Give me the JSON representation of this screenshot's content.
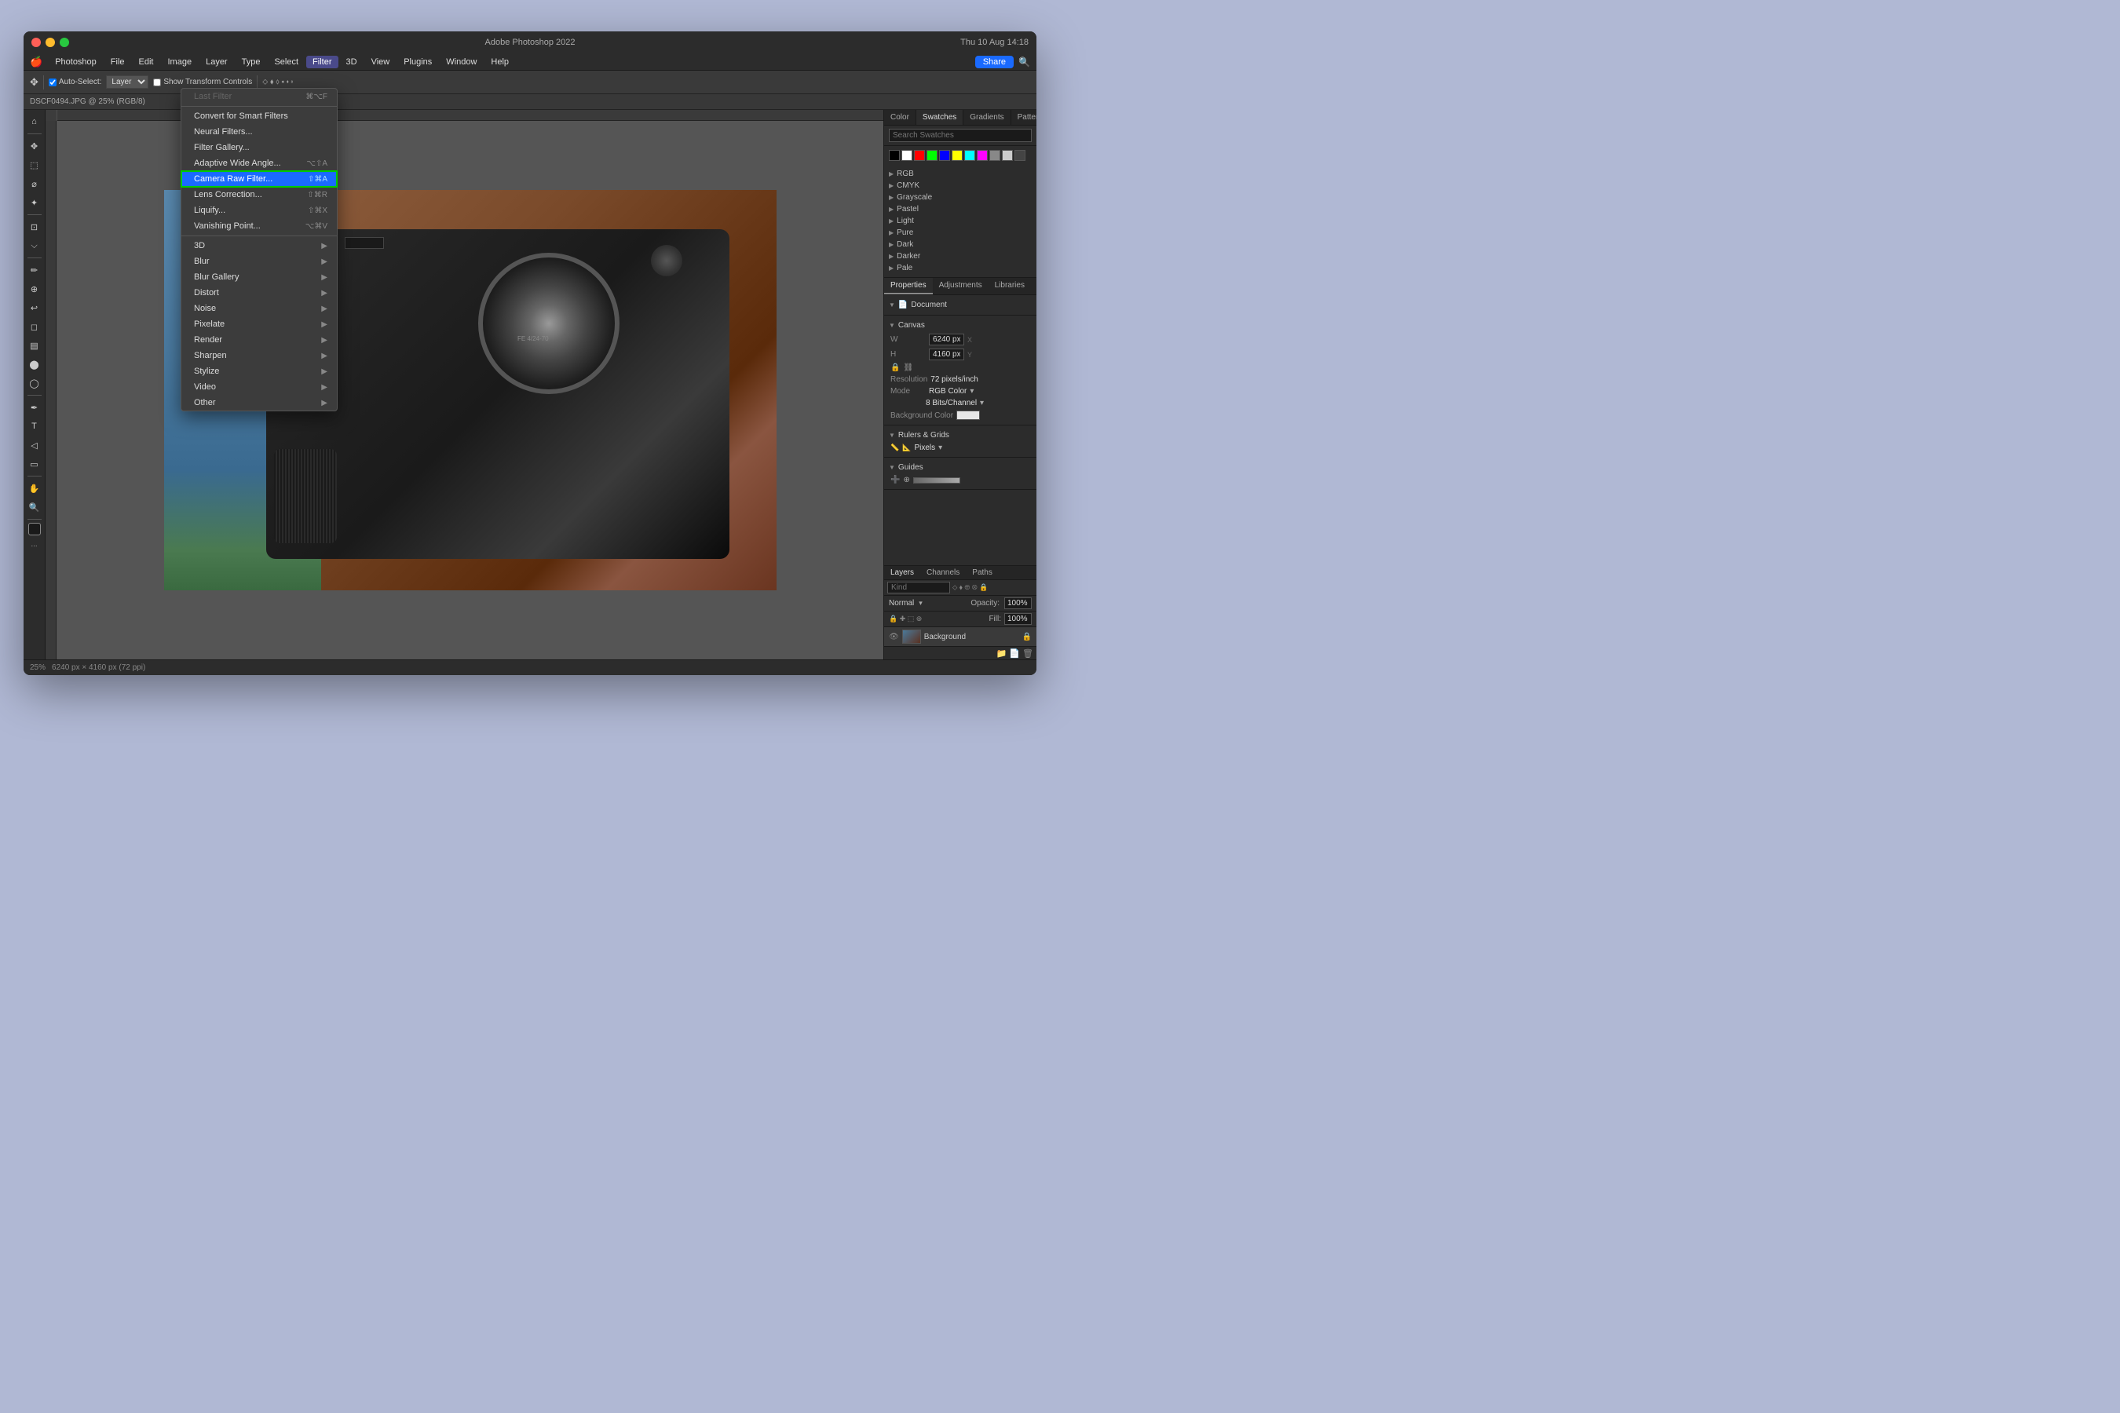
{
  "window": {
    "title": "Adobe Photoshop 2022",
    "datetime": "Thu 10 Aug  14:18"
  },
  "menubar": {
    "apple": "🍎",
    "items": [
      "Photoshop",
      "File",
      "Edit",
      "Image",
      "Layer",
      "Type",
      "Select",
      "Filter",
      "3D",
      "View",
      "Plugins",
      "Window",
      "Help"
    ]
  },
  "toolbar": {
    "auto_select_label": "Auto-Select:",
    "auto_select_value": "Layer",
    "show_transform": "Show Transform Controls"
  },
  "file_info": {
    "name": "DSCF0494.JPG @ 25% (RGB/8)",
    "zoom": "25%",
    "dimensions": "6240 px × 4160 px (72 ppi)"
  },
  "filter_menu": {
    "items": [
      {
        "label": "Last Filter",
        "shortcut": "⌘⌥F",
        "disabled": false,
        "id": "last-filter"
      },
      {
        "separator": true
      },
      {
        "label": "Convert for Smart Filters",
        "shortcut": "",
        "disabled": false
      },
      {
        "label": "Neural Filters...",
        "shortcut": "",
        "disabled": false
      },
      {
        "label": "Filter Gallery...",
        "shortcut": "",
        "disabled": false
      },
      {
        "label": "Adaptive Wide Angle...",
        "shortcut": "⌥⇧A",
        "disabled": false
      },
      {
        "label": "Camera Raw Filter...",
        "shortcut": "⇧⌘A",
        "disabled": false,
        "highlighted": true
      },
      {
        "label": "Lens Correction...",
        "shortcut": "⇧⌘R",
        "disabled": false
      },
      {
        "label": "Liquify...",
        "shortcut": "⇧⌘X",
        "disabled": false
      },
      {
        "label": "Vanishing Point...",
        "shortcut": "⌥⌘V",
        "disabled": false
      },
      {
        "separator": true
      },
      {
        "label": "3D",
        "hasSubmenu": true
      },
      {
        "label": "Blur",
        "hasSubmenu": true
      },
      {
        "label": "Blur Gallery",
        "hasSubmenu": true
      },
      {
        "label": "Distort",
        "hasSubmenu": true
      },
      {
        "label": "Noise",
        "hasSubmenu": true
      },
      {
        "label": "Pixelate",
        "hasSubmenu": true
      },
      {
        "label": "Render",
        "hasSubmenu": true
      },
      {
        "label": "Sharpen",
        "hasSubmenu": true
      },
      {
        "label": "Stylize",
        "hasSubmenu": true
      },
      {
        "label": "Video",
        "hasSubmenu": true
      },
      {
        "label": "Other",
        "hasSubmenu": true
      }
    ]
  },
  "swatches": {
    "panel_tabs": [
      "Color",
      "Swatches",
      "Gradients",
      "Patterns"
    ],
    "color_row": [
      "#000000",
      "#ffffff",
      "#ff0000",
      "#00ff00",
      "#0000ff",
      "#ffff00",
      "#ff00ff",
      "#00ffff",
      "#808080",
      "#c0c0c0"
    ],
    "groups": [
      "RGB",
      "CMYK",
      "Grayscale",
      "Pastel",
      "Light",
      "Pure",
      "Dark",
      "Darker",
      "Pale"
    ]
  },
  "properties": {
    "tabs": [
      "Properties",
      "Adjustments",
      "Libraries"
    ],
    "document_label": "Document",
    "canvas_section": "Canvas",
    "width_label": "W",
    "width_value": "6240 px",
    "height_label": "H",
    "height_value": "4160 px",
    "resolution_label": "Resolution",
    "resolution_value": "72 pixels/inch",
    "mode_label": "Mode",
    "mode_value": "RGB Color",
    "depth_value": "8 Bits/Channel",
    "bg_label": "Background Color",
    "rulers_section": "Rulers & Grids",
    "rulers_unit": "Pixels",
    "guides_section": "Guides"
  },
  "layers": {
    "tabs": [
      "Layers",
      "Channels",
      "Paths"
    ],
    "search_placeholder": "Kind",
    "mode": "Normal",
    "opacity_label": "Opacity:",
    "opacity_value": "100%",
    "fill_label": "Fill:",
    "fill_value": "100%",
    "layer_name": "Background",
    "lock_icon": "🔒"
  },
  "status_bar": {
    "zoom": "25%",
    "dimensions": "6240 px × 4160 px (72 ppi)"
  },
  "share_btn": "Share"
}
